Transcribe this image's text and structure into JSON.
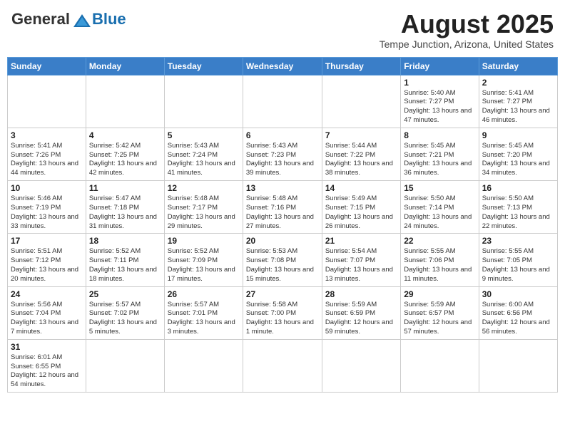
{
  "header": {
    "logo_general": "General",
    "logo_blue": "Blue",
    "month_title": "August 2025",
    "location": "Tempe Junction, Arizona, United States"
  },
  "weekdays": [
    "Sunday",
    "Monday",
    "Tuesday",
    "Wednesday",
    "Thursday",
    "Friday",
    "Saturday"
  ],
  "weeks": [
    [
      {
        "day": "",
        "info": ""
      },
      {
        "day": "",
        "info": ""
      },
      {
        "day": "",
        "info": ""
      },
      {
        "day": "",
        "info": ""
      },
      {
        "day": "",
        "info": ""
      },
      {
        "day": "1",
        "info": "Sunrise: 5:40 AM\nSunset: 7:27 PM\nDaylight: 13 hours and 47 minutes."
      },
      {
        "day": "2",
        "info": "Sunrise: 5:41 AM\nSunset: 7:27 PM\nDaylight: 13 hours and 46 minutes."
      }
    ],
    [
      {
        "day": "3",
        "info": "Sunrise: 5:41 AM\nSunset: 7:26 PM\nDaylight: 13 hours and 44 minutes."
      },
      {
        "day": "4",
        "info": "Sunrise: 5:42 AM\nSunset: 7:25 PM\nDaylight: 13 hours and 42 minutes."
      },
      {
        "day": "5",
        "info": "Sunrise: 5:43 AM\nSunset: 7:24 PM\nDaylight: 13 hours and 41 minutes."
      },
      {
        "day": "6",
        "info": "Sunrise: 5:43 AM\nSunset: 7:23 PM\nDaylight: 13 hours and 39 minutes."
      },
      {
        "day": "7",
        "info": "Sunrise: 5:44 AM\nSunset: 7:22 PM\nDaylight: 13 hours and 38 minutes."
      },
      {
        "day": "8",
        "info": "Sunrise: 5:45 AM\nSunset: 7:21 PM\nDaylight: 13 hours and 36 minutes."
      },
      {
        "day": "9",
        "info": "Sunrise: 5:45 AM\nSunset: 7:20 PM\nDaylight: 13 hours and 34 minutes."
      }
    ],
    [
      {
        "day": "10",
        "info": "Sunrise: 5:46 AM\nSunset: 7:19 PM\nDaylight: 13 hours and 33 minutes."
      },
      {
        "day": "11",
        "info": "Sunrise: 5:47 AM\nSunset: 7:18 PM\nDaylight: 13 hours and 31 minutes."
      },
      {
        "day": "12",
        "info": "Sunrise: 5:48 AM\nSunset: 7:17 PM\nDaylight: 13 hours and 29 minutes."
      },
      {
        "day": "13",
        "info": "Sunrise: 5:48 AM\nSunset: 7:16 PM\nDaylight: 13 hours and 27 minutes."
      },
      {
        "day": "14",
        "info": "Sunrise: 5:49 AM\nSunset: 7:15 PM\nDaylight: 13 hours and 26 minutes."
      },
      {
        "day": "15",
        "info": "Sunrise: 5:50 AM\nSunset: 7:14 PM\nDaylight: 13 hours and 24 minutes."
      },
      {
        "day": "16",
        "info": "Sunrise: 5:50 AM\nSunset: 7:13 PM\nDaylight: 13 hours and 22 minutes."
      }
    ],
    [
      {
        "day": "17",
        "info": "Sunrise: 5:51 AM\nSunset: 7:12 PM\nDaylight: 13 hours and 20 minutes."
      },
      {
        "day": "18",
        "info": "Sunrise: 5:52 AM\nSunset: 7:11 PM\nDaylight: 13 hours and 18 minutes."
      },
      {
        "day": "19",
        "info": "Sunrise: 5:52 AM\nSunset: 7:09 PM\nDaylight: 13 hours and 17 minutes."
      },
      {
        "day": "20",
        "info": "Sunrise: 5:53 AM\nSunset: 7:08 PM\nDaylight: 13 hours and 15 minutes."
      },
      {
        "day": "21",
        "info": "Sunrise: 5:54 AM\nSunset: 7:07 PM\nDaylight: 13 hours and 13 minutes."
      },
      {
        "day": "22",
        "info": "Sunrise: 5:55 AM\nSunset: 7:06 PM\nDaylight: 13 hours and 11 minutes."
      },
      {
        "day": "23",
        "info": "Sunrise: 5:55 AM\nSunset: 7:05 PM\nDaylight: 13 hours and 9 minutes."
      }
    ],
    [
      {
        "day": "24",
        "info": "Sunrise: 5:56 AM\nSunset: 7:04 PM\nDaylight: 13 hours and 7 minutes."
      },
      {
        "day": "25",
        "info": "Sunrise: 5:57 AM\nSunset: 7:02 PM\nDaylight: 13 hours and 5 minutes."
      },
      {
        "day": "26",
        "info": "Sunrise: 5:57 AM\nSunset: 7:01 PM\nDaylight: 13 hours and 3 minutes."
      },
      {
        "day": "27",
        "info": "Sunrise: 5:58 AM\nSunset: 7:00 PM\nDaylight: 13 hours and 1 minute."
      },
      {
        "day": "28",
        "info": "Sunrise: 5:59 AM\nSunset: 6:59 PM\nDaylight: 12 hours and 59 minutes."
      },
      {
        "day": "29",
        "info": "Sunrise: 5:59 AM\nSunset: 6:57 PM\nDaylight: 12 hours and 57 minutes."
      },
      {
        "day": "30",
        "info": "Sunrise: 6:00 AM\nSunset: 6:56 PM\nDaylight: 12 hours and 56 minutes."
      }
    ],
    [
      {
        "day": "31",
        "info": "Sunrise: 6:01 AM\nSunset: 6:55 PM\nDaylight: 12 hours and 54 minutes."
      },
      {
        "day": "",
        "info": ""
      },
      {
        "day": "",
        "info": ""
      },
      {
        "day": "",
        "info": ""
      },
      {
        "day": "",
        "info": ""
      },
      {
        "day": "",
        "info": ""
      },
      {
        "day": "",
        "info": ""
      }
    ]
  ]
}
